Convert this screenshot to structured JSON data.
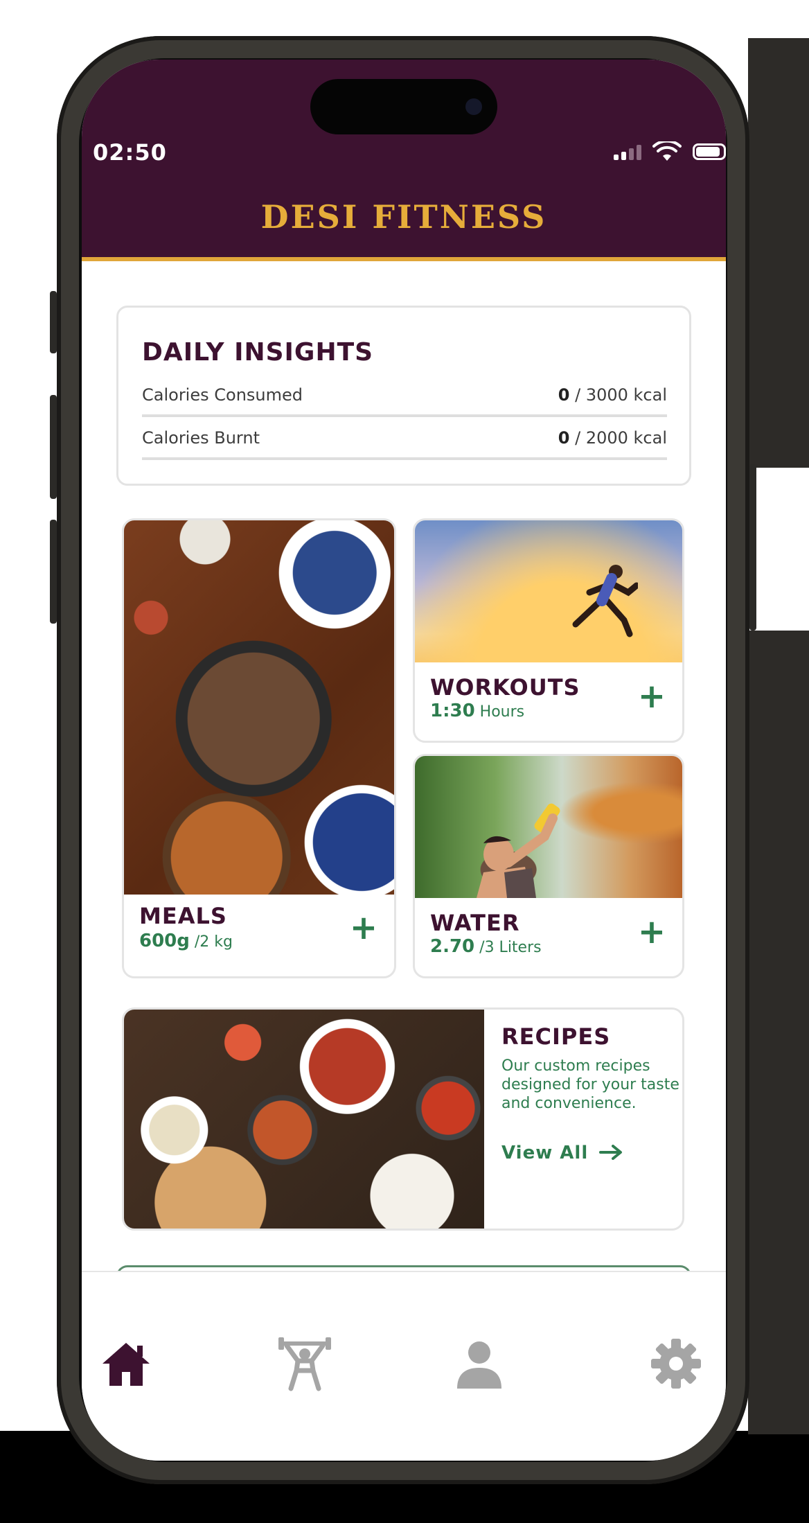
{
  "status": {
    "time": "02:50"
  },
  "app": {
    "title": "DESI FITNESS"
  },
  "insights": {
    "title": "DAILY INSIGHTS",
    "rows": [
      {
        "label": "Calories Consumed",
        "value": "0",
        "total": "/ 3000 kcal"
      },
      {
        "label": "Calories Burnt",
        "value": "0",
        "total": "/ 2000 kcal"
      }
    ]
  },
  "tiles": {
    "meals": {
      "title": "MEALS",
      "value": "600g",
      "unit": "/2 kg",
      "add_icon": "plus-icon"
    },
    "workouts": {
      "title": "WORKOUTS",
      "value": "1:30",
      "unit": "Hours",
      "add_icon": "plus-icon"
    },
    "water": {
      "title": "WATER",
      "value": "2.70",
      "unit": "/3 Liters",
      "add_icon": "plus-icon"
    }
  },
  "recipes": {
    "title": "RECIPES",
    "description": "Our custom recipes designed for your taste and convenience.",
    "link": "View All",
    "link_icon": "arrow-right-icon"
  },
  "tabbar": {
    "items": [
      {
        "icon": "home-icon",
        "active": true
      },
      {
        "icon": "workout-icon",
        "active": false
      },
      {
        "icon": "profile-icon",
        "active": false
      },
      {
        "icon": "settings-icon",
        "active": false
      }
    ]
  },
  "colors": {
    "header": "#3d1230",
    "accent_gold": "#e6ad3a",
    "green": "#2e7d4f",
    "tab_active": "#3d1230",
    "tab_inactive": "#a5a5a5"
  }
}
